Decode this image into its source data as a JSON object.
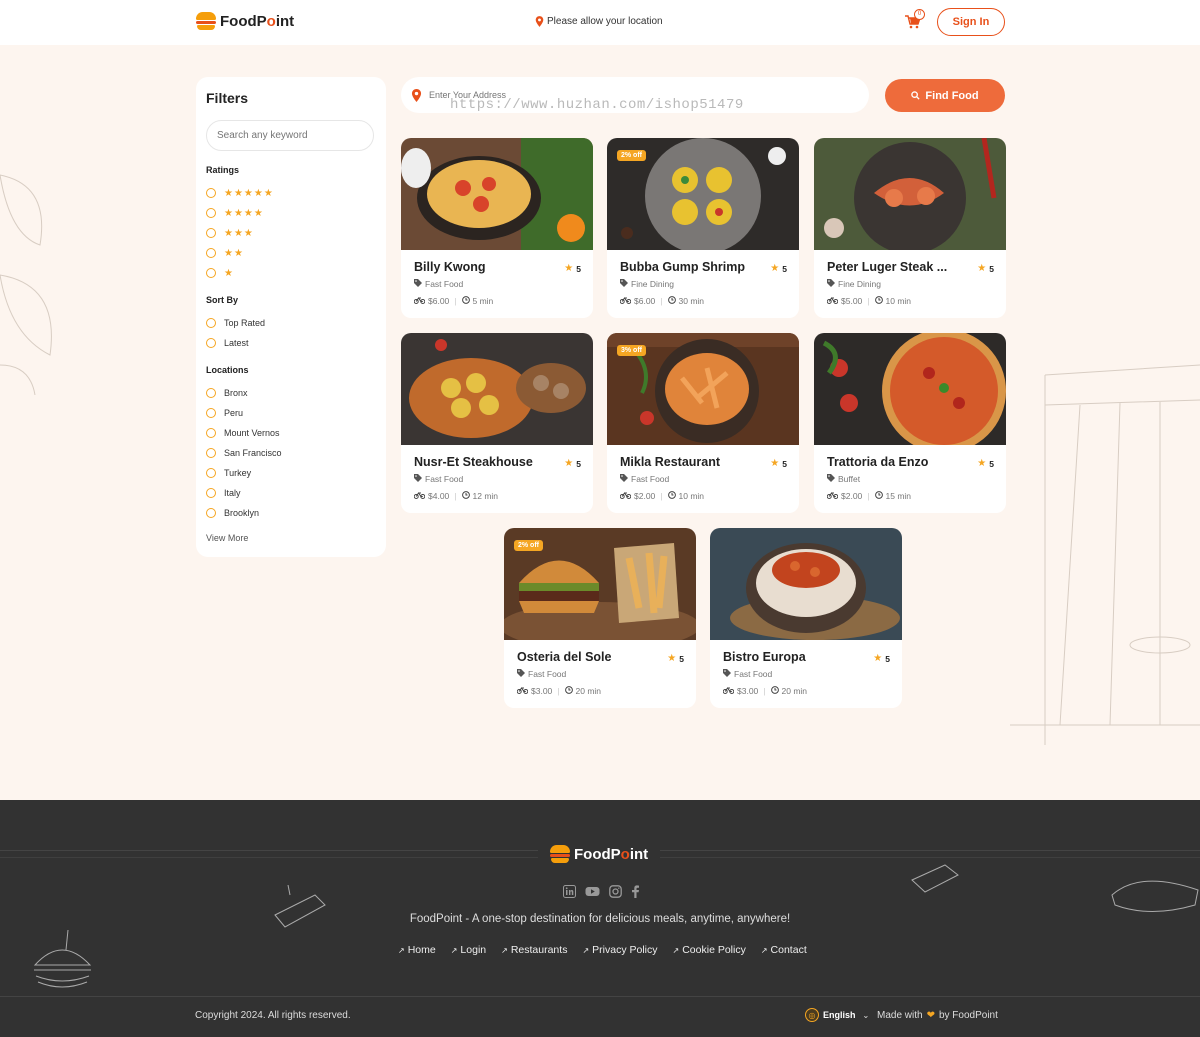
{
  "brand": {
    "name_pre": "FoodP",
    "name_o": "o",
    "name_post": "int"
  },
  "header": {
    "location_msg": "Please allow your location",
    "cart_count": "0",
    "signin_label": "Sign In"
  },
  "filters": {
    "title": "Filters",
    "keyword_placeholder": "Search any keyword",
    "ratings_title": "Ratings",
    "ratings": [
      5,
      4,
      3,
      2,
      1
    ],
    "sort_title": "Sort By",
    "sort_options": [
      "Top Rated",
      "Latest"
    ],
    "locations_title": "Locations",
    "locations": [
      "Bronx",
      "Peru",
      "Mount Vernos",
      "San Francisco",
      "Turkey",
      "Italy",
      "Brooklyn"
    ],
    "view_more": "View More"
  },
  "search": {
    "address_placeholder": "Enter Your Address",
    "find_label": "Find Food",
    "watermark": "https://www.huzhan.com/ishop51479"
  },
  "restaurants": [
    {
      "name": "Billy Kwong",
      "rating": "5",
      "category": "Fast Food",
      "price": "$6.00",
      "time": "5 min",
      "badge": "",
      "dish": "pizza-pan"
    },
    {
      "name": "Bubba Gump Shrimp",
      "rating": "5",
      "category": "Fine Dining",
      "price": "$6.00",
      "time": "30 min",
      "badge": "2% off",
      "dish": "nests"
    },
    {
      "name": "Peter Luger Steak ...",
      "rating": "5",
      "category": "Fine Dining",
      "price": "$5.00",
      "time": "10 min",
      "badge": "",
      "dish": "shrimp"
    },
    {
      "name": "Nusr-Et Steakhouse",
      "rating": "5",
      "category": "Fast Food",
      "price": "$4.00",
      "time": "12 min",
      "badge": "",
      "dish": "tarts"
    },
    {
      "name": "Mikla Restaurant",
      "rating": "5",
      "category": "Fast Food",
      "price": "$2.00",
      "time": "10 min",
      "badge": "3% off",
      "dish": "pasta"
    },
    {
      "name": "Trattoria da Enzo",
      "rating": "5",
      "category": "Buffet",
      "price": "$2.00",
      "time": "15 min",
      "badge": "",
      "dish": "pizza"
    },
    {
      "name": "Osteria del Sole",
      "rating": "5",
      "category": "Fast Food",
      "price": "$3.00",
      "time": "20 min",
      "badge": "2% off",
      "dish": "burger"
    },
    {
      "name": "Bistro Europa",
      "rating": "5",
      "category": "Fast Food",
      "price": "$3.00",
      "time": "20 min",
      "badge": "",
      "dish": "curry"
    }
  ],
  "footer": {
    "tagline": "FoodPoint - A one-stop destination for delicious meals, anytime, anywhere!",
    "links": [
      "Home",
      "Login",
      "Restaurants",
      "Privacy Policy",
      "Cookie Policy",
      "Contact"
    ],
    "socials": [
      "linkedin-icon",
      "youtube-icon",
      "instagram-icon",
      "facebook-icon"
    ],
    "copyright": "Copyright 2024. All rights reserved.",
    "language": "English",
    "made_with_pre": "Made with",
    "made_with_post": "by FoodPoint"
  },
  "colors": {
    "accent": "#ee6b3b",
    "star": "#f5a623",
    "bg": "#fdf5ef",
    "footer": "#323232"
  }
}
